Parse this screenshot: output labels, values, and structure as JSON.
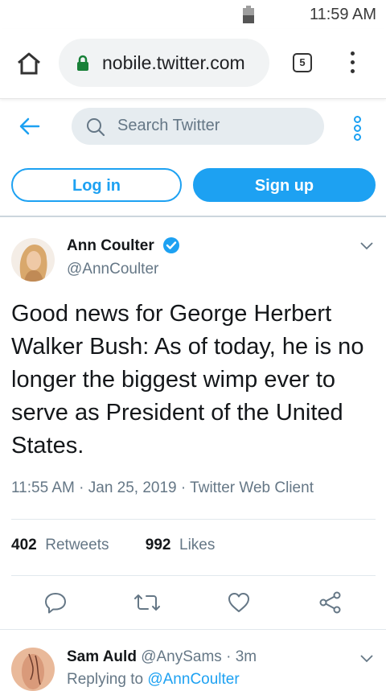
{
  "status": {
    "time": "11:59 AM"
  },
  "browser": {
    "url": "nobile.twitter.com",
    "tab_count": "5"
  },
  "twitter": {
    "search_placeholder": "Search Twitter",
    "login_label": "Log in",
    "signup_label": "Sign up"
  },
  "tweet": {
    "name": "Ann Coulter",
    "handle": "@AnnCoulter",
    "text": "Good news for George Herbert Walker Bush: As of today, he is no longer the biggest wimp ever to serve as President of the United States.",
    "meta": "11:55 AM · Jan 25, 2019 · Twitter Web Client",
    "retweets_count": "402",
    "retweets_label": "Retweets",
    "likes_count": "992",
    "likes_label": "Likes"
  },
  "reply": {
    "name": "Sam Auld",
    "handle": "@AnySams",
    "time": "· 3m",
    "replying_label": "Replying to",
    "replying_handle": "@AnnCoulter"
  },
  "colors": {
    "accent": "#1da1f2",
    "secondary_text": "#657786"
  }
}
